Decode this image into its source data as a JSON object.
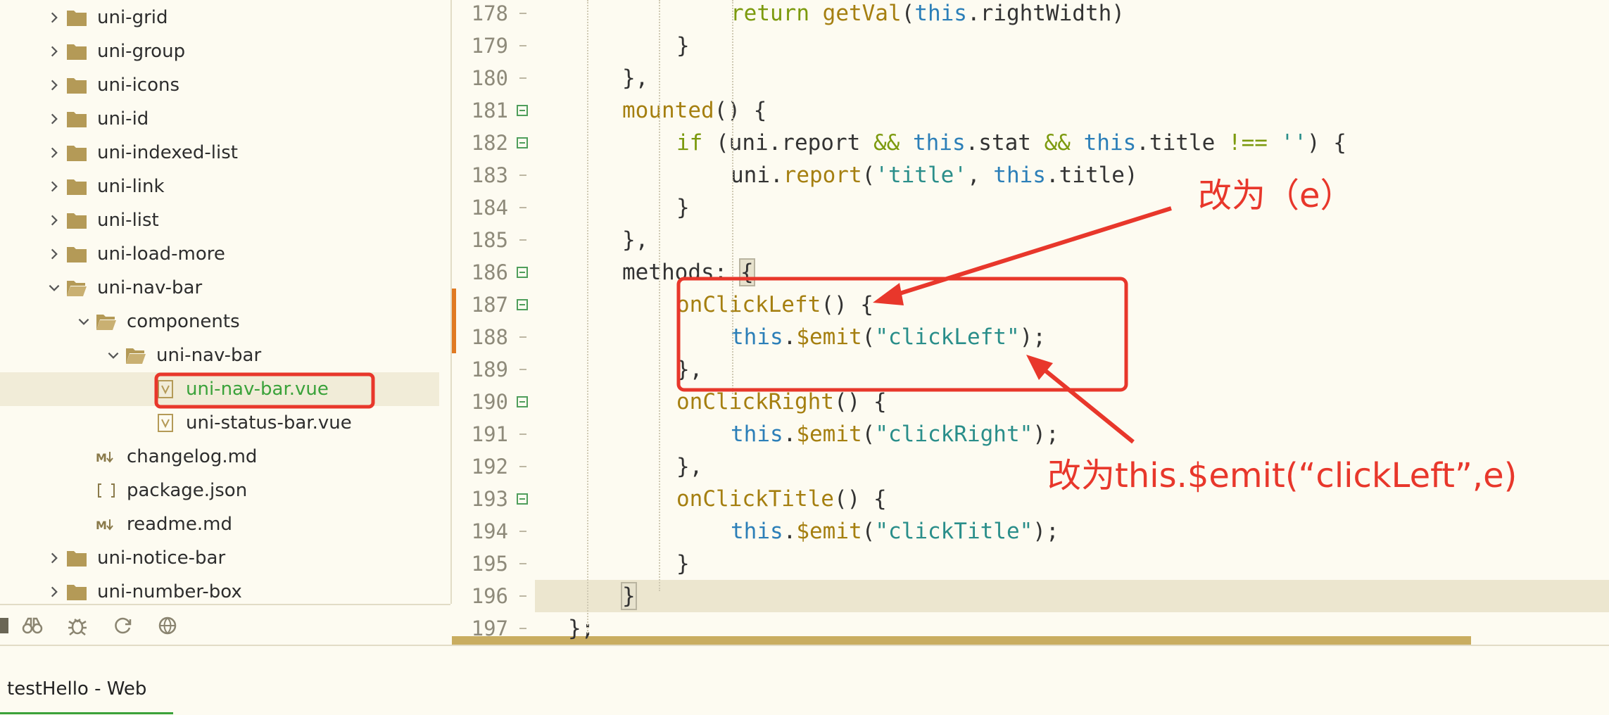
{
  "tree": {
    "items": [
      {
        "label": "uni-grid",
        "type": "folder",
        "expanded": false,
        "depth": 0
      },
      {
        "label": "uni-group",
        "type": "folder",
        "expanded": false,
        "depth": 0
      },
      {
        "label": "uni-icons",
        "type": "folder",
        "expanded": false,
        "depth": 0
      },
      {
        "label": "uni-id",
        "type": "folder",
        "expanded": false,
        "depth": 0
      },
      {
        "label": "uni-indexed-list",
        "type": "folder",
        "expanded": false,
        "depth": 0
      },
      {
        "label": "uni-link",
        "type": "folder",
        "expanded": false,
        "depth": 0
      },
      {
        "label": "uni-list",
        "type": "folder",
        "expanded": false,
        "depth": 0
      },
      {
        "label": "uni-load-more",
        "type": "folder",
        "expanded": false,
        "depth": 0
      },
      {
        "label": "uni-nav-bar",
        "type": "folder-open",
        "expanded": true,
        "depth": 0
      },
      {
        "label": "components",
        "type": "folder-open",
        "expanded": true,
        "depth": 1
      },
      {
        "label": "uni-nav-bar",
        "type": "folder-open",
        "expanded": true,
        "depth": 2
      },
      {
        "label": "uni-nav-bar.vue",
        "type": "vue",
        "depth": 3,
        "selected": true
      },
      {
        "label": "uni-status-bar.vue",
        "type": "vue",
        "depth": 3
      },
      {
        "label": "changelog.md",
        "type": "md",
        "depth": 1
      },
      {
        "label": "package.json",
        "type": "json",
        "depth": 1
      },
      {
        "label": "readme.md",
        "type": "md",
        "depth": 1
      },
      {
        "label": "uni-notice-bar",
        "type": "folder",
        "expanded": false,
        "depth": 0
      },
      {
        "label": "uni-number-box",
        "type": "folder",
        "expanded": false,
        "depth": 0
      }
    ],
    "toolbar": [
      "binoculars-icon",
      "bug-icon",
      "refresh-icon",
      "globe-icon"
    ]
  },
  "editor": {
    "lines": [
      {
        "num": "178",
        "indent": 4,
        "tokens": [
          [
            "kw",
            "return "
          ],
          [
            "fn",
            "getVal"
          ],
          [
            "p",
            "("
          ],
          [
            "th",
            "this"
          ],
          [
            "p",
            ".rightWidth)"
          ]
        ]
      },
      {
        "num": "179",
        "indent": 3,
        "tokens": [
          [
            "p",
            "}"
          ]
        ]
      },
      {
        "num": "180",
        "indent": 2,
        "tokens": [
          [
            "p",
            "},"
          ]
        ]
      },
      {
        "num": "181",
        "indent": 2,
        "fold": true,
        "tokens": [
          [
            "fn",
            "mounted"
          ],
          [
            "p",
            "() {"
          ]
        ]
      },
      {
        "num": "182",
        "indent": 3,
        "fold": true,
        "tokens": [
          [
            "kw",
            "if"
          ],
          [
            "p",
            " (uni.report "
          ],
          [
            "kw",
            "&&"
          ],
          [
            "p",
            " "
          ],
          [
            "th",
            "this"
          ],
          [
            "p",
            ".stat "
          ],
          [
            "kw",
            "&&"
          ],
          [
            "p",
            " "
          ],
          [
            "th",
            "this"
          ],
          [
            "p",
            ".title "
          ],
          [
            "kw",
            "!=="
          ],
          [
            "p",
            " "
          ],
          [
            "str",
            "''"
          ],
          [
            "p",
            ") {"
          ]
        ]
      },
      {
        "num": "183",
        "indent": 4,
        "tokens": [
          [
            "p",
            "uni."
          ],
          [
            "fn",
            "report"
          ],
          [
            "p",
            "("
          ],
          [
            "str",
            "'title'"
          ],
          [
            "p",
            ", "
          ],
          [
            "th",
            "this"
          ],
          [
            "p",
            ".title)"
          ]
        ]
      },
      {
        "num": "184",
        "indent": 3,
        "tokens": [
          [
            "p",
            "}"
          ]
        ]
      },
      {
        "num": "185",
        "indent": 2,
        "tokens": [
          [
            "p",
            "},"
          ]
        ]
      },
      {
        "num": "186",
        "indent": 2,
        "fold": true,
        "tokens": [
          [
            "p",
            "methods: "
          ],
          [
            "hl",
            "{"
          ]
        ]
      },
      {
        "num": "187",
        "indent": 3,
        "fold": true,
        "tokens": [
          [
            "fn",
            "onClickLeft"
          ],
          [
            "p",
            "() {"
          ]
        ]
      },
      {
        "num": "188",
        "indent": 4,
        "tokens": [
          [
            "th",
            "this"
          ],
          [
            "p",
            "."
          ],
          [
            "fn",
            "$emit"
          ],
          [
            "p",
            "("
          ],
          [
            "str",
            "\"clickLeft\""
          ],
          [
            "p",
            ");"
          ]
        ]
      },
      {
        "num": "189",
        "indent": 3,
        "tokens": [
          [
            "p",
            "},"
          ]
        ]
      },
      {
        "num": "190",
        "indent": 3,
        "fold": true,
        "tokens": [
          [
            "fn",
            "onClickRight"
          ],
          [
            "p",
            "() {"
          ]
        ]
      },
      {
        "num": "191",
        "indent": 4,
        "tokens": [
          [
            "th",
            "this"
          ],
          [
            "p",
            "."
          ],
          [
            "fn",
            "$emit"
          ],
          [
            "p",
            "("
          ],
          [
            "str",
            "\"clickRight\""
          ],
          [
            "p",
            ");"
          ]
        ]
      },
      {
        "num": "192",
        "indent": 3,
        "tokens": [
          [
            "p",
            "},"
          ]
        ]
      },
      {
        "num": "193",
        "indent": 3,
        "fold": true,
        "tokens": [
          [
            "fn",
            "onClickTitle"
          ],
          [
            "p",
            "() {"
          ]
        ]
      },
      {
        "num": "194",
        "indent": 4,
        "tokens": [
          [
            "th",
            "this"
          ],
          [
            "p",
            "."
          ],
          [
            "fn",
            "$emit"
          ],
          [
            "p",
            "("
          ],
          [
            "str",
            "\"clickTitle\""
          ],
          [
            "p",
            ");"
          ]
        ]
      },
      {
        "num": "195",
        "indent": 3,
        "tokens": [
          [
            "p",
            "}"
          ]
        ]
      },
      {
        "num": "196",
        "indent": 2,
        "current": true,
        "tokens": [
          [
            "hl",
            "}"
          ]
        ]
      },
      {
        "num": "197",
        "indent": 1,
        "tokens": [
          [
            "p",
            "};"
          ]
        ]
      }
    ]
  },
  "annotations": {
    "note1": "改为（e）",
    "note2": "改为this.$emit(“clickLeft”,e)",
    "color": "#e8372b"
  },
  "status": {
    "title": "testHello - Web"
  }
}
